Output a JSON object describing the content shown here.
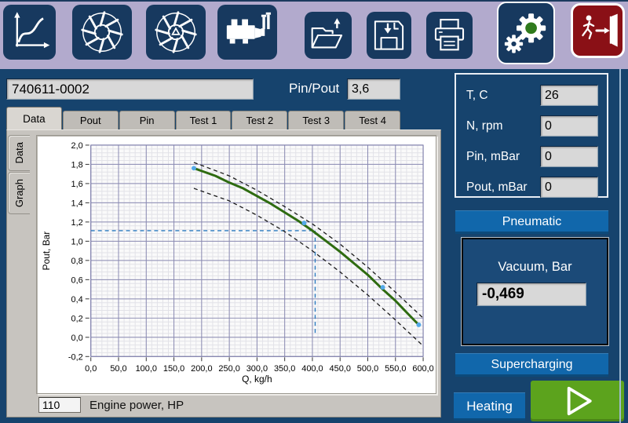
{
  "toolbar": {
    "icons": [
      "chart-icon",
      "fan-icon",
      "fan-delta-icon",
      "compressor-icon",
      "folder-open-icon",
      "save-icon",
      "print-icon",
      "gears-icon",
      "exit-icon"
    ],
    "gear_center_color": "#2f7a1c",
    "exit_bg_color": "#8a1016"
  },
  "header": {
    "serial_value": "740611-0002",
    "pin_pout_label": "Pin/Pout",
    "pin_pout_value": "3,6"
  },
  "tabs": {
    "items": [
      "Data",
      "Pout",
      "Pin",
      "Test 1",
      "Test 2",
      "Test 3",
      "Test 4"
    ],
    "active": "Data"
  },
  "side_tabs": {
    "items": [
      "Data",
      "Graph"
    ],
    "active": "Graph"
  },
  "sensors": {
    "rows": [
      {
        "label": "T, C",
        "value": "26"
      },
      {
        "label": "N, rpm",
        "value": "0"
      },
      {
        "label": "Pin, mBar",
        "value": "0"
      },
      {
        "label": "Pout, mBar",
        "value": "0"
      }
    ]
  },
  "controls": {
    "pneumatic": "Pneumatic",
    "supercharging": "Supercharging",
    "heating": "Heating",
    "start_icon": "play-icon"
  },
  "vacuum": {
    "title": "Vacuum, Bar",
    "value": "-0,469"
  },
  "engine_power": {
    "value": "110",
    "label": "Engine power, HP"
  },
  "colors": {
    "toolbar_bg": "#b2aacd",
    "main_bg": "#16436d",
    "button_navy": "#17395f",
    "accent_blue": "#1167ab",
    "play_green": "#5ca31d",
    "curve_green": "#2e6b10",
    "marker_blue": "#54a9e8",
    "cursor_blue": "#2b7bc0"
  },
  "chart_data": {
    "type": "line",
    "title": "",
    "xlabel": "Q, kg/h",
    "ylabel": "Pout, Bar",
    "xlim": [
      0,
      600
    ],
    "ylim": [
      -0.2,
      2.0
    ],
    "xtick_step": 50,
    "ytick_step": 0.2,
    "grid": true,
    "legend": "none",
    "series": [
      {
        "name": "target-curve",
        "color": "#2e6b10",
        "width": 3,
        "dashed": false,
        "points": [
          [
            186,
            1.76
          ],
          [
            225,
            1.68
          ],
          [
            250,
            1.61
          ],
          [
            275,
            1.55
          ],
          [
            300,
            1.47
          ],
          [
            325,
            1.39
          ],
          [
            350,
            1.3
          ],
          [
            375,
            1.21
          ],
          [
            400,
            1.11
          ],
          [
            425,
            1.0
          ],
          [
            450,
            0.89
          ],
          [
            475,
            0.77
          ],
          [
            500,
            0.65
          ],
          [
            525,
            0.51
          ],
          [
            550,
            0.38
          ],
          [
            575,
            0.23
          ],
          [
            592,
            0.13
          ]
        ]
      },
      {
        "name": "upper-tolerance",
        "color": "#1a1a1a",
        "width": 1.3,
        "dashed": true,
        "points": [
          [
            186,
            1.82
          ],
          [
            250,
            1.68
          ],
          [
            300,
            1.53
          ],
          [
            350,
            1.36
          ],
          [
            400,
            1.18
          ],
          [
            450,
            0.97
          ],
          [
            500,
            0.73
          ],
          [
            550,
            0.47
          ],
          [
            600,
            0.2
          ]
        ]
      },
      {
        "name": "lower-tolerance",
        "color": "#1a1a1a",
        "width": 1.3,
        "dashed": true,
        "points": [
          [
            186,
            1.55
          ],
          [
            250,
            1.42
          ],
          [
            300,
            1.27
          ],
          [
            350,
            1.1
          ],
          [
            400,
            0.9
          ],
          [
            450,
            0.68
          ],
          [
            500,
            0.44
          ],
          [
            550,
            0.18
          ],
          [
            600,
            -0.09
          ]
        ]
      }
    ],
    "markers": {
      "name": "measured-points",
      "color": "#54a9e8",
      "points": [
        [
          186,
          1.76
        ],
        [
          385,
          1.19
        ],
        [
          527,
          0.52
        ],
        [
          592,
          0.13
        ]
      ]
    },
    "cursor": {
      "x": 405,
      "y": 1.11,
      "color": "#2b7bc0"
    }
  }
}
